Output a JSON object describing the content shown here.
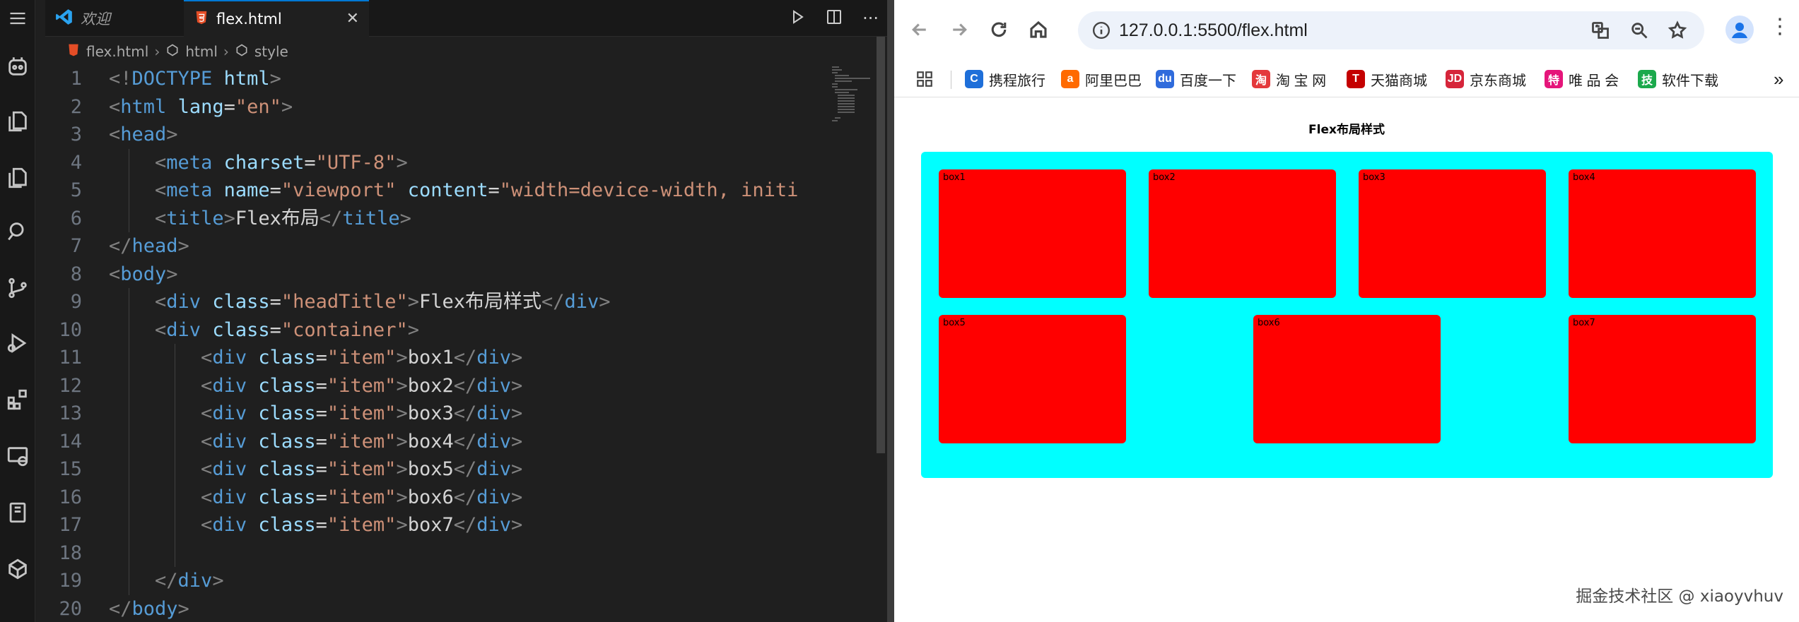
{
  "editor": {
    "tabs": [
      {
        "label": "欢迎"
      },
      {
        "label": "flex.html"
      }
    ],
    "breadcrumb": [
      "flex.html",
      "html",
      "style"
    ],
    "lines": [
      {
        "n": "1",
        "indent": 0,
        "parts": [
          [
            "lt",
            "<!"
          ],
          [
            "tg",
            "DOCTYPE"
          ],
          [
            "tx",
            " "
          ],
          [
            "at",
            "html"
          ],
          [
            "lt",
            ">"
          ]
        ]
      },
      {
        "n": "2",
        "indent": 0,
        "parts": [
          [
            "lt",
            "<"
          ],
          [
            "tg",
            "html"
          ],
          [
            "tx",
            " "
          ],
          [
            "at",
            "lang"
          ],
          [
            "tx",
            "="
          ],
          [
            "st",
            "\"en\""
          ],
          [
            "lt",
            ">"
          ]
        ]
      },
      {
        "n": "3",
        "indent": 0,
        "parts": [
          [
            "lt",
            "<"
          ],
          [
            "tg",
            "head"
          ],
          [
            "lt",
            ">"
          ]
        ]
      },
      {
        "n": "4",
        "indent": 1,
        "parts": [
          [
            "lt",
            "<"
          ],
          [
            "tg",
            "meta"
          ],
          [
            "tx",
            " "
          ],
          [
            "at",
            "charset"
          ],
          [
            "tx",
            "="
          ],
          [
            "st",
            "\"UTF-8\""
          ],
          [
            "lt",
            ">"
          ]
        ]
      },
      {
        "n": "5",
        "indent": 1,
        "parts": [
          [
            "lt",
            "<"
          ],
          [
            "tg",
            "meta"
          ],
          [
            "tx",
            " "
          ],
          [
            "at",
            "name"
          ],
          [
            "tx",
            "="
          ],
          [
            "st",
            "\"viewport\""
          ],
          [
            "tx",
            " "
          ],
          [
            "at",
            "content"
          ],
          [
            "tx",
            "="
          ],
          [
            "st",
            "\"width=device-width, initi"
          ]
        ]
      },
      {
        "n": "6",
        "indent": 1,
        "parts": [
          [
            "lt",
            "<"
          ],
          [
            "tg",
            "title"
          ],
          [
            "lt",
            ">"
          ],
          [
            "tx",
            "Flex布局"
          ],
          [
            "lt",
            "</"
          ],
          [
            "tg",
            "title"
          ],
          [
            "lt",
            ">"
          ]
        ]
      },
      {
        "n": "7",
        "indent": 0,
        "parts": [
          [
            "lt",
            "</"
          ],
          [
            "tg",
            "head"
          ],
          [
            "lt",
            ">"
          ]
        ]
      },
      {
        "n": "8",
        "indent": 0,
        "parts": [
          [
            "lt",
            "<"
          ],
          [
            "tg",
            "body"
          ],
          [
            "lt",
            ">"
          ]
        ]
      },
      {
        "n": "9",
        "indent": 1,
        "parts": [
          [
            "lt",
            "<"
          ],
          [
            "tg",
            "div"
          ],
          [
            "tx",
            " "
          ],
          [
            "at",
            "class"
          ],
          [
            "tx",
            "="
          ],
          [
            "st",
            "\"headTitle\""
          ],
          [
            "lt",
            ">"
          ],
          [
            "tx",
            "Flex布局样式"
          ],
          [
            "lt",
            "</"
          ],
          [
            "tg",
            "div"
          ],
          [
            "lt",
            ">"
          ]
        ]
      },
      {
        "n": "10",
        "indent": 1,
        "parts": [
          [
            "lt",
            "<"
          ],
          [
            "tg",
            "div"
          ],
          [
            "tx",
            " "
          ],
          [
            "at",
            "class"
          ],
          [
            "tx",
            "="
          ],
          [
            "st",
            "\"container\""
          ],
          [
            "lt",
            ">"
          ]
        ]
      },
      {
        "n": "11",
        "indent": 2,
        "parts": [
          [
            "lt",
            "<"
          ],
          [
            "tg",
            "div"
          ],
          [
            "tx",
            " "
          ],
          [
            "at",
            "class"
          ],
          [
            "tx",
            "="
          ],
          [
            "st",
            "\"item\""
          ],
          [
            "lt",
            ">"
          ],
          [
            "tx",
            "box1"
          ],
          [
            "lt",
            "</"
          ],
          [
            "tg",
            "div"
          ],
          [
            "lt",
            ">"
          ]
        ]
      },
      {
        "n": "12",
        "indent": 2,
        "parts": [
          [
            "lt",
            "<"
          ],
          [
            "tg",
            "div"
          ],
          [
            "tx",
            " "
          ],
          [
            "at",
            "class"
          ],
          [
            "tx",
            "="
          ],
          [
            "st",
            "\"item\""
          ],
          [
            "lt",
            ">"
          ],
          [
            "tx",
            "box2"
          ],
          [
            "lt",
            "</"
          ],
          [
            "tg",
            "div"
          ],
          [
            "lt",
            ">"
          ]
        ]
      },
      {
        "n": "13",
        "indent": 2,
        "parts": [
          [
            "lt",
            "<"
          ],
          [
            "tg",
            "div"
          ],
          [
            "tx",
            " "
          ],
          [
            "at",
            "class"
          ],
          [
            "tx",
            "="
          ],
          [
            "st",
            "\"item\""
          ],
          [
            "lt",
            ">"
          ],
          [
            "tx",
            "box3"
          ],
          [
            "lt",
            "</"
          ],
          [
            "tg",
            "div"
          ],
          [
            "lt",
            ">"
          ]
        ]
      },
      {
        "n": "14",
        "indent": 2,
        "parts": [
          [
            "lt",
            "<"
          ],
          [
            "tg",
            "div"
          ],
          [
            "tx",
            " "
          ],
          [
            "at",
            "class"
          ],
          [
            "tx",
            "="
          ],
          [
            "st",
            "\"item\""
          ],
          [
            "lt",
            ">"
          ],
          [
            "tx",
            "box4"
          ],
          [
            "lt",
            "</"
          ],
          [
            "tg",
            "div"
          ],
          [
            "lt",
            ">"
          ]
        ]
      },
      {
        "n": "15",
        "indent": 2,
        "parts": [
          [
            "lt",
            "<"
          ],
          [
            "tg",
            "div"
          ],
          [
            "tx",
            " "
          ],
          [
            "at",
            "class"
          ],
          [
            "tx",
            "="
          ],
          [
            "st",
            "\"item\""
          ],
          [
            "lt",
            ">"
          ],
          [
            "tx",
            "box5"
          ],
          [
            "lt",
            "</"
          ],
          [
            "tg",
            "div"
          ],
          [
            "lt",
            ">"
          ]
        ]
      },
      {
        "n": "16",
        "indent": 2,
        "parts": [
          [
            "lt",
            "<"
          ],
          [
            "tg",
            "div"
          ],
          [
            "tx",
            " "
          ],
          [
            "at",
            "class"
          ],
          [
            "tx",
            "="
          ],
          [
            "st",
            "\"item\""
          ],
          [
            "lt",
            ">"
          ],
          [
            "tx",
            "box6"
          ],
          [
            "lt",
            "</"
          ],
          [
            "tg",
            "div"
          ],
          [
            "lt",
            ">"
          ]
        ]
      },
      {
        "n": "17",
        "indent": 2,
        "parts": [
          [
            "lt",
            "<"
          ],
          [
            "tg",
            "div"
          ],
          [
            "tx",
            " "
          ],
          [
            "at",
            "class"
          ],
          [
            "tx",
            "="
          ],
          [
            "st",
            "\"item\""
          ],
          [
            "lt",
            ">"
          ],
          [
            "tx",
            "box7"
          ],
          [
            "lt",
            "</"
          ],
          [
            "tg",
            "div"
          ],
          [
            "lt",
            ">"
          ]
        ]
      },
      {
        "n": "18",
        "indent": 0,
        "parts": []
      },
      {
        "n": "19",
        "indent": 1,
        "parts": [
          [
            "lt",
            "</"
          ],
          [
            "tg",
            "div"
          ],
          [
            "lt",
            ">"
          ]
        ]
      },
      {
        "n": "20",
        "indent": 0,
        "parts": [
          [
            "lt",
            "</"
          ],
          [
            "tg",
            "body"
          ],
          [
            "lt",
            ">"
          ]
        ]
      }
    ]
  },
  "browser": {
    "url": "127.0.0.1:5500/flex.html",
    "bookmarks": [
      {
        "label": "携程旅行",
        "icon_color": "#1e6fd9",
        "glyph": "C"
      },
      {
        "label": "阿里巴巴",
        "icon_color": "#ff6a00",
        "glyph": "a"
      },
      {
        "label": "百度一下",
        "icon_color": "#2f6bdc",
        "glyph": "du"
      },
      {
        "label": "淘 宝 网",
        "icon_color": "#e4393c",
        "glyph": "淘"
      },
      {
        "label": "天猫商城",
        "icon_color": "#c40000",
        "glyph": "T"
      },
      {
        "label": "京东商城",
        "icon_color": "#d6253a",
        "glyph": "JD"
      },
      {
        "label": "唯 品 会",
        "icon_color": "#e5157a",
        "glyph": "特"
      },
      {
        "label": "软件下载",
        "icon_color": "#1ba94c",
        "glyph": "技"
      }
    ],
    "page": {
      "head_title": "Flex布局样式",
      "boxes": [
        "box1",
        "box2",
        "box3",
        "box4",
        "box5",
        "box6",
        "box7"
      ],
      "container_color": "#00ffff",
      "item_color": "#ff0000"
    },
    "watermark": "掘金技术社区 @ xiaoyvhuv"
  }
}
